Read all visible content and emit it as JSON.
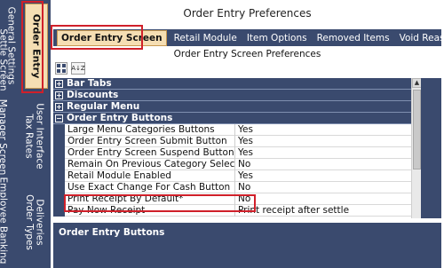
{
  "left_tabs": {
    "active": "Order Entry",
    "items": [
      {
        "label": "General Settings"
      },
      {
        "label": "Settle Screen"
      },
      {
        "label": "Manager Screen"
      },
      {
        "label": "User Interface"
      },
      {
        "label": "Tax Rates"
      },
      {
        "label": "Deliveries"
      },
      {
        "label": "Order Types"
      },
      {
        "label": "Employee Banking"
      }
    ]
  },
  "header": {
    "title": "Order Entry Preferences"
  },
  "tabs": [
    {
      "label": "Order Entry Screen",
      "active": true
    },
    {
      "label": "Retail Module"
    },
    {
      "label": "Item Options"
    },
    {
      "label": "Removed Items"
    },
    {
      "label": "Void Reasons"
    }
  ],
  "subtitle": "Order Entry Screen Preferences",
  "toolbar": {
    "categorized_icon": "categorized-icon",
    "sort_icon": "sort-az-icon",
    "sort_label": "A↓Z"
  },
  "categories": [
    {
      "label": "Bar Tabs",
      "expander": "+"
    },
    {
      "label": "Discounts",
      "expander": "+"
    },
    {
      "label": "Regular Menu",
      "expander": "+"
    },
    {
      "label": "Order Entry Buttons",
      "expander": "−"
    }
  ],
  "properties": [
    {
      "name": "Large Menu Categories Buttons",
      "value": "Yes"
    },
    {
      "name": "Order Entry Screen Submit Button",
      "value": "Yes"
    },
    {
      "name": "Order Entry Screen Suspend Button",
      "value": "Yes"
    },
    {
      "name": "Remain On Previous Category Selection",
      "value": "No"
    },
    {
      "name": "Retail Module Enabled",
      "value": "Yes"
    },
    {
      "name": "Use Exact Change For Cash Button",
      "value": "No"
    },
    {
      "name": "Print Receipt By Default*",
      "value": "No"
    },
    {
      "name": "Pay Now Receipt",
      "value": "Print receipt after settle"
    }
  ],
  "description": {
    "title": "Order Entry Buttons"
  },
  "scrollbar": {
    "up": "▲",
    "down": "▼"
  }
}
